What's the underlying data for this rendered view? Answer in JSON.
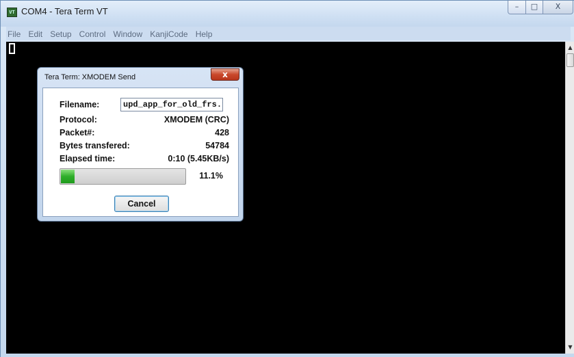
{
  "window": {
    "title": "COM4 - Tera Term VT",
    "app_icon_text": "VT",
    "min_label": "–",
    "max_label": "□",
    "close_label": "X"
  },
  "menu": [
    "File",
    "Edit",
    "Setup",
    "Control",
    "Window",
    "KanjiCode",
    "Help"
  ],
  "scrollbar": {
    "up": "▲",
    "down": "▼"
  },
  "dialog": {
    "title": "Tera Term: XMODEM Send",
    "close_label": "x",
    "filename_label": "Filename:",
    "filename_value": "upd_app_for_old_frs.t",
    "protocol_label": "Protocol:",
    "protocol_value": "XMODEM (CRC)",
    "packet_label": "Packet#:",
    "packet_value": "428",
    "bytes_label": "Bytes transfered:",
    "bytes_value": "54784",
    "elapsed_label": "Elapsed time:",
    "elapsed_value": "0:10 (5.45KB/s)",
    "progress_percent": "11.1%",
    "progress_fraction": 0.111,
    "cancel_label": "Cancel"
  },
  "colors": {
    "terminal_bg": "#000000",
    "progress_fill": "#2fae2a",
    "close_button": "#c9482b"
  }
}
